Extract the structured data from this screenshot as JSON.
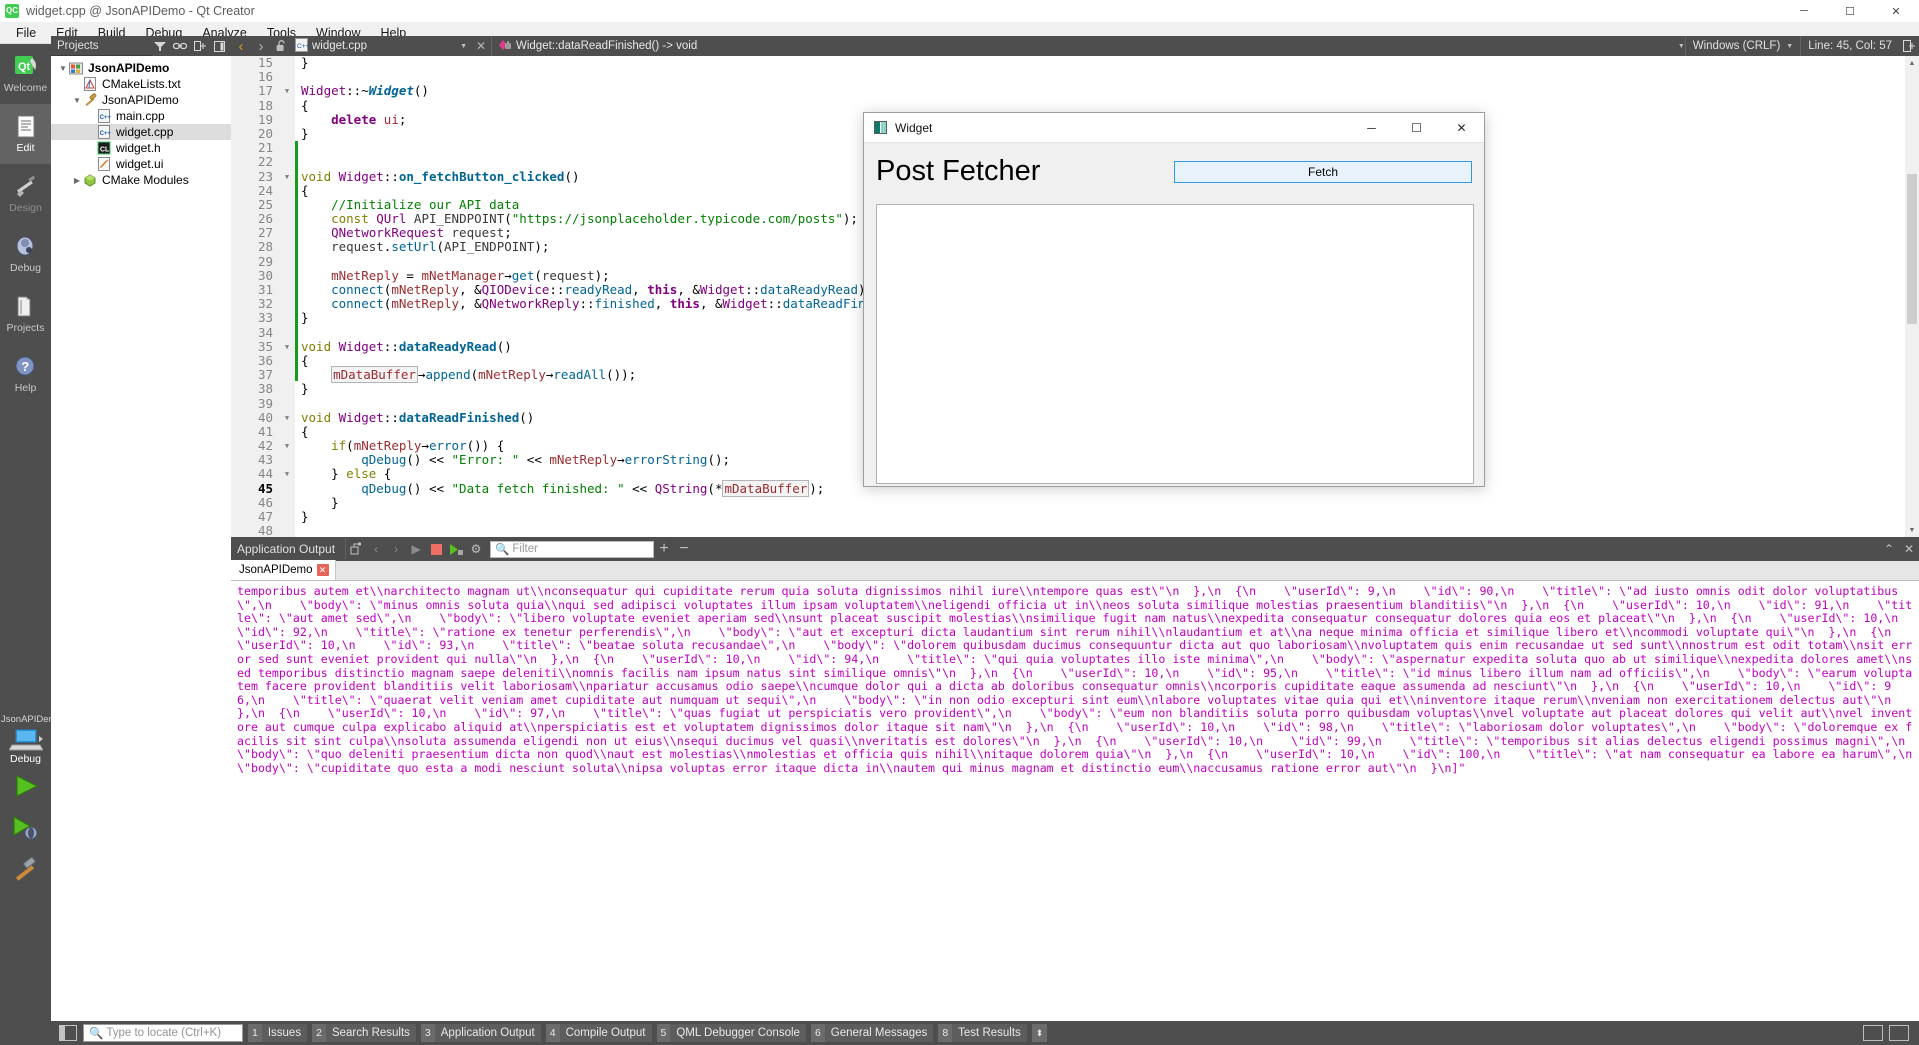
{
  "window": {
    "title": "widget.cpp @ JsonAPIDemo - Qt Creator",
    "app_icon": "qt-logo-icon",
    "minimize": "─",
    "maximize": "☐",
    "close": "✕"
  },
  "menubar": {
    "items": [
      "File",
      "Edit",
      "Build",
      "Debug",
      "Analyze",
      "Tools",
      "Window",
      "Help"
    ]
  },
  "modebar": {
    "items": [
      {
        "label": "Welcome",
        "icon": "qt-welcome-icon",
        "active": false
      },
      {
        "label": "Edit",
        "icon": "edit-document-icon",
        "active": true
      },
      {
        "label": "Design",
        "icon": "design-brush-icon",
        "active": false,
        "dim": true
      },
      {
        "label": "Debug",
        "icon": "debug-bug-icon",
        "active": false
      },
      {
        "label": "Projects",
        "icon": "projects-book-icon",
        "active": false
      },
      {
        "label": "Help",
        "icon": "help-question-icon",
        "active": false
      }
    ],
    "kit_name": "JsonAPIDemo",
    "kit_build": "Debug",
    "kit_icon": "computer-monitor-icon",
    "run_button": "run-green-triangle-icon",
    "debug_button": "debug-run-icon",
    "build_button": "build-hammer-icon"
  },
  "project_panel": {
    "selector_label": "Projects",
    "toolbar_icons": [
      "filter-icon",
      "link-sync-icon",
      "expand-all-icon",
      "hide-sidebar-icon"
    ],
    "tree": [
      {
        "label": "JsonAPIDemo",
        "indent": 0,
        "arrow": "⌄",
        "icon": "project-icon",
        "icon_bg": "#e06c3c",
        "bold": true,
        "selected": false
      },
      {
        "label": "CMakeLists.txt",
        "indent": 1,
        "arrow": "",
        "icon": "cmake-file-icon",
        "icon_bg": "#f2f2f2",
        "bold": false,
        "selected": false
      },
      {
        "label": "JsonAPIDemo",
        "indent": 1,
        "arrow": "⌄",
        "icon": "target-hammer-icon",
        "icon_bg": "#d9a441",
        "bold": false,
        "selected": false
      },
      {
        "label": "main.cpp",
        "indent": 2,
        "arrow": "",
        "icon": "cpp-file-icon",
        "icon_bg": "#f4f4f4",
        "bold": false,
        "selected": false
      },
      {
        "label": "widget.cpp",
        "indent": 2,
        "arrow": "",
        "icon": "cpp-file-icon",
        "icon_bg": "#f4f4f4",
        "bold": false,
        "selected": true
      },
      {
        "label": "widget.h",
        "indent": 2,
        "arrow": "",
        "icon": "header-file-icon",
        "icon_bg": "#1d1d1d",
        "bold": false,
        "selected": false
      },
      {
        "label": "widget.ui",
        "indent": 2,
        "arrow": "",
        "icon": "ui-file-icon",
        "icon_bg": "#f7f7f7",
        "bold": false,
        "selected": false
      },
      {
        "label": "CMake Modules",
        "indent": 1,
        "arrow": "›",
        "icon": "cmake-modules-icon",
        "icon_bg": "#8ec63f",
        "bold": false,
        "selected": false
      }
    ]
  },
  "editor_toolbar": {
    "back": "‹",
    "forward": "›",
    "lock": "lock-open-icon",
    "file_name": "widget.cpp",
    "file_icon": "cpp-file-icon",
    "close_tab": "✕",
    "symbol": "Widget::dataReadFinished() -> void",
    "symbol_icon": "method-symbol-icon",
    "line_ending": "Windows (CRLF)",
    "cursor_position": "Line: 45, Col: 57",
    "split_icon": "split-editor-icon"
  },
  "code": {
    "lines": [
      {
        "n": 15,
        "fold": "",
        "cur": false,
        "html": "<span class=\"op\">}</span>"
      },
      {
        "n": 16,
        "fold": "",
        "cur": false,
        "html": ""
      },
      {
        "n": 17,
        "fold": "▼",
        "cur": false,
        "html": "<span class=\"ty\">Widget</span><span class=\"op\">::~</span><span class=\"fn\"><i>Widget</i></span><span class=\"op\">()</span>"
      },
      {
        "n": 18,
        "fold": "",
        "cur": false,
        "html": "<span class=\"op\">{</span>"
      },
      {
        "n": 19,
        "fold": "",
        "cur": false,
        "html": "    <span class=\"k\">delete</span> <span class=\"fld\">ui</span><span class=\"op\">;</span>"
      },
      {
        "n": 20,
        "fold": "",
        "cur": false,
        "html": "<span class=\"op\">}</span>"
      },
      {
        "n": 21,
        "fold": "",
        "cur": false,
        "html": ""
      },
      {
        "n": 22,
        "fold": "",
        "cur": false,
        "html": ""
      },
      {
        "n": 23,
        "fold": "▼",
        "cur": false,
        "html": "<span class=\"ko\">void</span> <span class=\"ty\">Widget</span><span class=\"op\">::</span><span class=\"fn\">on_fetchButton_clicked</span><span class=\"op\">()</span>"
      },
      {
        "n": 24,
        "fold": "",
        "cur": false,
        "html": "<span class=\"op\">{</span>"
      },
      {
        "n": 25,
        "fold": "",
        "cur": false,
        "html": "    <span class=\"cm\">//Initialize our API data</span>"
      },
      {
        "n": 26,
        "fold": "",
        "cur": false,
        "html": "    <span class=\"ko\">const</span> <span class=\"ty\">QUrl</span> <span class=\"loc\">API_ENDPOINT</span><span class=\"op\">(</span><span class=\"st\">\"https://jsonplaceholder.typicode.com/posts\"</span><span class=\"op\">);</span>"
      },
      {
        "n": 27,
        "fold": "",
        "cur": false,
        "html": "    <span class=\"ty\">QNetworkRequest</span> <span class=\"loc\">request</span><span class=\"op\">;</span>"
      },
      {
        "n": 28,
        "fold": "",
        "cur": false,
        "html": "    <span class=\"loc\">request</span><span class=\"op\">.</span><span class=\"mem\">setUrl</span><span class=\"op\">(</span><span class=\"loc\">API_ENDPOINT</span><span class=\"op\">);</span>"
      },
      {
        "n": 29,
        "fold": "",
        "cur": false,
        "html": ""
      },
      {
        "n": 30,
        "fold": "",
        "cur": false,
        "html": "    <span class=\"fld\">mNetReply</span> <span class=\"op\">=</span> <span class=\"fld\">mNetManager</span><span class=\"op\">→</span><span class=\"mem\">get</span><span class=\"op\">(</span><span class=\"loc\">request</span><span class=\"op\">);</span>"
      },
      {
        "n": 31,
        "fold": "",
        "cur": false,
        "html": "    <span class=\"mem\">connect</span><span class=\"op\">(</span><span class=\"fld\">mNetReply</span><span class=\"op\">, &amp;</span><span class=\"ty\">QIODevice</span><span class=\"op\">::</span><span class=\"mem\">readyRead</span><span class=\"op\">, </span><span class=\"k\">this</span><span class=\"op\">, &amp;</span><span class=\"ty\">Widget</span><span class=\"op\">::</span><span class=\"mem\">dataReadyRead</span><span class=\"op\">);</span>"
      },
      {
        "n": 32,
        "fold": "",
        "cur": false,
        "html": "    <span class=\"mem\">connect</span><span class=\"op\">(</span><span class=\"fld\">mNetReply</span><span class=\"op\">, &amp;</span><span class=\"ty\">QNetworkReply</span><span class=\"op\">::</span><span class=\"mem\">finished</span><span class=\"op\">, </span><span class=\"k\">this</span><span class=\"op\">, &amp;</span><span class=\"ty\">Widget</span><span class=\"op\">::</span><span class=\"mem\">dataReadFinished</span><span class=\"op\">);</span>"
      },
      {
        "n": 33,
        "fold": "",
        "cur": false,
        "html": "<span class=\"op\">}</span>"
      },
      {
        "n": 34,
        "fold": "",
        "cur": false,
        "html": ""
      },
      {
        "n": 35,
        "fold": "▼",
        "cur": false,
        "html": "<span class=\"ko\">void</span> <span class=\"ty\">Widget</span><span class=\"op\">::</span><span class=\"fn\">dataReadyRead</span><span class=\"op\">()</span>"
      },
      {
        "n": 36,
        "fold": "",
        "cur": false,
        "html": "<span class=\"op\">{</span>"
      },
      {
        "n": 37,
        "fold": "",
        "cur": false,
        "html": "    <span class=\"boxed\">mDataBuffer</span><span class=\"op\">→</span><span class=\"mem\">append</span><span class=\"op\">(</span><span class=\"fld\">mNetReply</span><span class=\"op\">→</span><span class=\"mem\">readAll</span><span class=\"op\">());</span>"
      },
      {
        "n": 38,
        "fold": "",
        "cur": false,
        "html": "<span class=\"op\">}</span>"
      },
      {
        "n": 39,
        "fold": "",
        "cur": false,
        "html": ""
      },
      {
        "n": 40,
        "fold": "▼",
        "cur": false,
        "html": "<span class=\"ko\">void</span> <span class=\"ty\">Widget</span><span class=\"op\">::</span><span class=\"fn\">dataReadFinished</span><span class=\"op\">()</span>"
      },
      {
        "n": 41,
        "fold": "",
        "cur": false,
        "html": "<span class=\"op\">{</span>"
      },
      {
        "n": 42,
        "fold": "▼",
        "cur": false,
        "html": "    <span class=\"ko\">if</span><span class=\"op\">(</span><span class=\"fld\">mNetReply</span><span class=\"op\">→</span><span class=\"mem\">error</span><span class=\"op\">()) {</span>"
      },
      {
        "n": 43,
        "fold": "",
        "cur": false,
        "html": "        <span class=\"mem\">qDebug</span><span class=\"op\">() &lt;&lt; </span><span class=\"st\">\"Error: \"</span><span class=\"op\"> &lt;&lt; </span><span class=\"fld\">mNetReply</span><span class=\"op\">→</span><span class=\"mem\">errorString</span><span class=\"op\">();</span>"
      },
      {
        "n": 44,
        "fold": "▼",
        "cur": false,
        "html": "    <span class=\"op\">} </span><span class=\"ko\">else</span><span class=\"op\"> {</span>"
      },
      {
        "n": 45,
        "fold": "",
        "cur": true,
        "html": "        <span class=\"mem\">qDebug</span><span class=\"op\">() &lt;&lt; </span><span class=\"st\">\"Data fetch finished: \"</span><span class=\"op\"> &lt;&lt; </span><span class=\"ty\">QString</span><span class=\"op\">(*</span><span class=\"boxed\">mDataBuffer</span><span class=\"op\">);</span>"
      },
      {
        "n": 46,
        "fold": "",
        "cur": false,
        "html": "    <span class=\"op\">}</span>"
      },
      {
        "n": 47,
        "fold": "",
        "cur": false,
        "html": "<span class=\"op\">}</span>"
      },
      {
        "n": 48,
        "fold": "",
        "cur": false,
        "html": ""
      }
    ]
  },
  "output_pane": {
    "title": "Application Output",
    "toolbar_icons": [
      "attach-debugger-icon",
      "prev-item-icon",
      "next-item-icon",
      "run-icon",
      "stop-icon",
      "rerun-icon",
      "settings-gear-icon"
    ],
    "filter_placeholder": "Filter",
    "zoom_in": "+",
    "zoom_out": "−",
    "maximize_icon": "⌃",
    "close_icon": "✕",
    "tab_label": "JsonAPIDemo",
    "tab_close_badge": "✕",
    "text": "temporibus autem et\\\\narchitecto magnam ut\\\\nconsequatur qui cupiditate rerum quia soluta dignissimos nihil iure\\\\ntempore quas est\\\"\\n  },\\n  {\\n    \\\"userId\\\": 9,\\n    \\\"id\\\": 90,\\n    \\\"title\\\": \\\"ad iusto omnis odit dolor voluptatibus\\\",\\n    \\\"body\\\": \\\"minus omnis soluta quia\\\\nqui sed adipisci voluptates illum ipsam voluptatem\\\\neligendi officia ut in\\\\neos soluta similique molestias praesentium blanditiis\\\"\\n  },\\n  {\\n    \\\"userId\\\": 10,\\n    \\\"id\\\": 91,\\n    \\\"title\\\": \\\"aut amet sed\\\",\\n    \\\"body\\\": \\\"libero voluptate eveniet aperiam sed\\\\nsunt placeat suscipit molestias\\\\nsimilique fugit nam natus\\\\nexpedita consequatur consequatur dolores quia eos et placeat\\\"\\n  },\\n  {\\n    \\\"userId\\\": 10,\\n    \\\"id\\\": 92,\\n    \\\"title\\\": \\\"ratione ex tenetur perferendis\\\",\\n    \\\"body\\\": \\\"aut et excepturi dicta laudantium sint rerum nihil\\\\nlaudantium et at\\\\na neque minima officia et similique libero et\\\\ncommodi voluptate qui\\\"\\n  },\\n  {\\n    \\\"userId\\\": 10,\\n    \\\"id\\\": 93,\\n    \\\"title\\\": \\\"beatae soluta recusandae\\\",\\n    \\\"body\\\": \\\"dolorem quibusdam ducimus consequuntur dicta aut quo laboriosam\\\\nvoluptatem quis enim recusandae ut sed sunt\\\\nnostrum est odit totam\\\\nsit error sed sunt eveniet provident qui nulla\\\"\\n  },\\n  {\\n    \\\"userId\\\": 10,\\n    \\\"id\\\": 94,\\n    \\\"title\\\": \\\"qui quia voluptates illo iste minima\\\",\\n    \\\"body\\\": \\\"aspernatur expedita soluta quo ab ut similique\\\\nexpedita dolores amet\\\\nsed temporibus distinctio magnam saepe deleniti\\\\nomnis facilis nam ipsum natus sint similique omnis\\\"\\n  },\\n  {\\n    \\\"userId\\\": 10,\\n    \\\"id\\\": 95,\\n    \\\"title\\\": \\\"id minus libero illum nam ad officiis\\\",\\n    \\\"body\\\": \\\"earum voluptatem facere provident blanditiis velit laboriosam\\\\npariatur accusamus odio saepe\\\\ncumque dolor qui a dicta ab doloribus consequatur omnis\\\\ncorporis cupiditate eaque assumenda ad nesciunt\\\"\\n  },\\n  {\\n    \\\"userId\\\": 10,\\n    \\\"id\\\": 96,\\n    \\\"title\\\": \\\"quaerat velit veniam amet cupiditate aut numquam ut sequi\\\",\\n    \\\"body\\\": \\\"in non odio excepturi sint eum\\\\nlabore voluptates vitae quia qui et\\\\ninventore itaque rerum\\\\nveniam non exercitationem delectus aut\\\"\\n  },\\n  {\\n    \\\"userId\\\": 10,\\n    \\\"id\\\": 97,\\n    \\\"title\\\": \\\"quas fugiat ut perspiciatis vero provident\\\",\\n    \\\"body\\\": \\\"eum non blanditiis soluta porro quibusdam voluptas\\\\nvel voluptate aut placeat dolores qui velit aut\\\\nvel inventore aut cumque culpa explicabo aliquid at\\\\nperspiciatis est et voluptatem dignissimos dolor itaque sit nam\\\"\\n  },\\n  {\\n    \\\"userId\\\": 10,\\n    \\\"id\\\": 98,\\n    \\\"title\\\": \\\"laboriosam dolor voluptates\\\",\\n    \\\"body\\\": \\\"doloremque ex facilis sit sint culpa\\\\nsoluta assumenda eligendi non ut eius\\\\nsequi ducimus vel quasi\\\\nveritatis est dolores\\\"\\n  },\\n  {\\n    \\\"userId\\\": 10,\\n    \\\"id\\\": 99,\\n    \\\"title\\\": \\\"temporibus sit alias delectus eligendi possimus magni\\\",\\n    \\\"body\\\": \\\"quo deleniti praesentium dicta non quod\\\\naut est molestias\\\\nmolestias et officia quis nihil\\\\nitaque dolorem quia\\\"\\n  },\\n  {\\n    \\\"userId\\\": 10,\\n    \\\"id\\\": 100,\\n    \\\"title\\\": \\\"at nam consequatur ea labore ea harum\\\",\\n    \\\"body\\\": \\\"cupiditate quo esta a modi nesciunt soluta\\\\nipsa voluptas error itaque dicta in\\\\nautem qui minus magnam et distinctio eum\\\\naccusamus ratione error aut\\\"\\n  }\\n]\""
  },
  "statusbar": {
    "sidebar_toggle_icon": "toggle-sidebar-icon",
    "locator_placeholder": "Type to locate (Ctrl+K)",
    "locator_icon": "search-icon",
    "tabs": [
      {
        "num": "1",
        "name": "Issues"
      },
      {
        "num": "2",
        "name": "Search Results"
      },
      {
        "num": "3",
        "name": "Application Output"
      },
      {
        "num": "4",
        "name": "Compile Output"
      },
      {
        "num": "5",
        "name": "QML Debugger Console"
      },
      {
        "num": "6",
        "name": "General Messages"
      },
      {
        "num": "8",
        "name": "Test Results"
      }
    ],
    "updown_icon": "⬍",
    "right_icons": [
      "progress-detail-icon",
      "close-panel-icon"
    ]
  },
  "widget_dialog": {
    "title": "Widget",
    "icon": "widget-app-icon",
    "minimize": "─",
    "maximize": "☐",
    "close": "✕",
    "heading": "Post Fetcher",
    "fetch_button": "Fetch",
    "textarea_value": "",
    "accent_color": "#3399dd"
  }
}
